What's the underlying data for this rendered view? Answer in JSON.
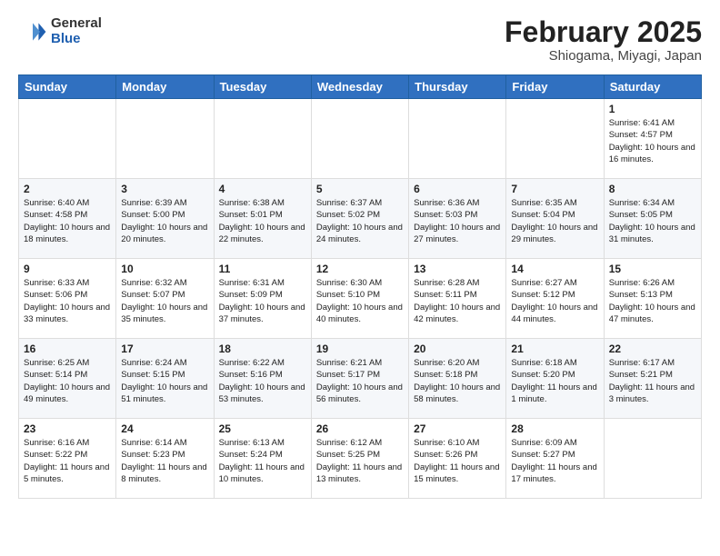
{
  "logo": {
    "general": "General",
    "blue": "Blue"
  },
  "header": {
    "title": "February 2025",
    "location": "Shiogama, Miyagi, Japan"
  },
  "weekdays": [
    "Sunday",
    "Monday",
    "Tuesday",
    "Wednesday",
    "Thursday",
    "Friday",
    "Saturday"
  ],
  "weeks": [
    [
      {
        "day": "",
        "info": ""
      },
      {
        "day": "",
        "info": ""
      },
      {
        "day": "",
        "info": ""
      },
      {
        "day": "",
        "info": ""
      },
      {
        "day": "",
        "info": ""
      },
      {
        "day": "",
        "info": ""
      },
      {
        "day": "1",
        "info": "Sunrise: 6:41 AM\nSunset: 4:57 PM\nDaylight: 10 hours and 16 minutes."
      }
    ],
    [
      {
        "day": "2",
        "info": "Sunrise: 6:40 AM\nSunset: 4:58 PM\nDaylight: 10 hours and 18 minutes."
      },
      {
        "day": "3",
        "info": "Sunrise: 6:39 AM\nSunset: 5:00 PM\nDaylight: 10 hours and 20 minutes."
      },
      {
        "day": "4",
        "info": "Sunrise: 6:38 AM\nSunset: 5:01 PM\nDaylight: 10 hours and 22 minutes."
      },
      {
        "day": "5",
        "info": "Sunrise: 6:37 AM\nSunset: 5:02 PM\nDaylight: 10 hours and 24 minutes."
      },
      {
        "day": "6",
        "info": "Sunrise: 6:36 AM\nSunset: 5:03 PM\nDaylight: 10 hours and 27 minutes."
      },
      {
        "day": "7",
        "info": "Sunrise: 6:35 AM\nSunset: 5:04 PM\nDaylight: 10 hours and 29 minutes."
      },
      {
        "day": "8",
        "info": "Sunrise: 6:34 AM\nSunset: 5:05 PM\nDaylight: 10 hours and 31 minutes."
      }
    ],
    [
      {
        "day": "9",
        "info": "Sunrise: 6:33 AM\nSunset: 5:06 PM\nDaylight: 10 hours and 33 minutes."
      },
      {
        "day": "10",
        "info": "Sunrise: 6:32 AM\nSunset: 5:07 PM\nDaylight: 10 hours and 35 minutes."
      },
      {
        "day": "11",
        "info": "Sunrise: 6:31 AM\nSunset: 5:09 PM\nDaylight: 10 hours and 37 minutes."
      },
      {
        "day": "12",
        "info": "Sunrise: 6:30 AM\nSunset: 5:10 PM\nDaylight: 10 hours and 40 minutes."
      },
      {
        "day": "13",
        "info": "Sunrise: 6:28 AM\nSunset: 5:11 PM\nDaylight: 10 hours and 42 minutes."
      },
      {
        "day": "14",
        "info": "Sunrise: 6:27 AM\nSunset: 5:12 PM\nDaylight: 10 hours and 44 minutes."
      },
      {
        "day": "15",
        "info": "Sunrise: 6:26 AM\nSunset: 5:13 PM\nDaylight: 10 hours and 47 minutes."
      }
    ],
    [
      {
        "day": "16",
        "info": "Sunrise: 6:25 AM\nSunset: 5:14 PM\nDaylight: 10 hours and 49 minutes."
      },
      {
        "day": "17",
        "info": "Sunrise: 6:24 AM\nSunset: 5:15 PM\nDaylight: 10 hours and 51 minutes."
      },
      {
        "day": "18",
        "info": "Sunrise: 6:22 AM\nSunset: 5:16 PM\nDaylight: 10 hours and 53 minutes."
      },
      {
        "day": "19",
        "info": "Sunrise: 6:21 AM\nSunset: 5:17 PM\nDaylight: 10 hours and 56 minutes."
      },
      {
        "day": "20",
        "info": "Sunrise: 6:20 AM\nSunset: 5:18 PM\nDaylight: 10 hours and 58 minutes."
      },
      {
        "day": "21",
        "info": "Sunrise: 6:18 AM\nSunset: 5:20 PM\nDaylight: 11 hours and 1 minute."
      },
      {
        "day": "22",
        "info": "Sunrise: 6:17 AM\nSunset: 5:21 PM\nDaylight: 11 hours and 3 minutes."
      }
    ],
    [
      {
        "day": "23",
        "info": "Sunrise: 6:16 AM\nSunset: 5:22 PM\nDaylight: 11 hours and 5 minutes."
      },
      {
        "day": "24",
        "info": "Sunrise: 6:14 AM\nSunset: 5:23 PM\nDaylight: 11 hours and 8 minutes."
      },
      {
        "day": "25",
        "info": "Sunrise: 6:13 AM\nSunset: 5:24 PM\nDaylight: 11 hours and 10 minutes."
      },
      {
        "day": "26",
        "info": "Sunrise: 6:12 AM\nSunset: 5:25 PM\nDaylight: 11 hours and 13 minutes."
      },
      {
        "day": "27",
        "info": "Sunrise: 6:10 AM\nSunset: 5:26 PM\nDaylight: 11 hours and 15 minutes."
      },
      {
        "day": "28",
        "info": "Sunrise: 6:09 AM\nSunset: 5:27 PM\nDaylight: 11 hours and 17 minutes."
      },
      {
        "day": "",
        "info": ""
      }
    ]
  ]
}
